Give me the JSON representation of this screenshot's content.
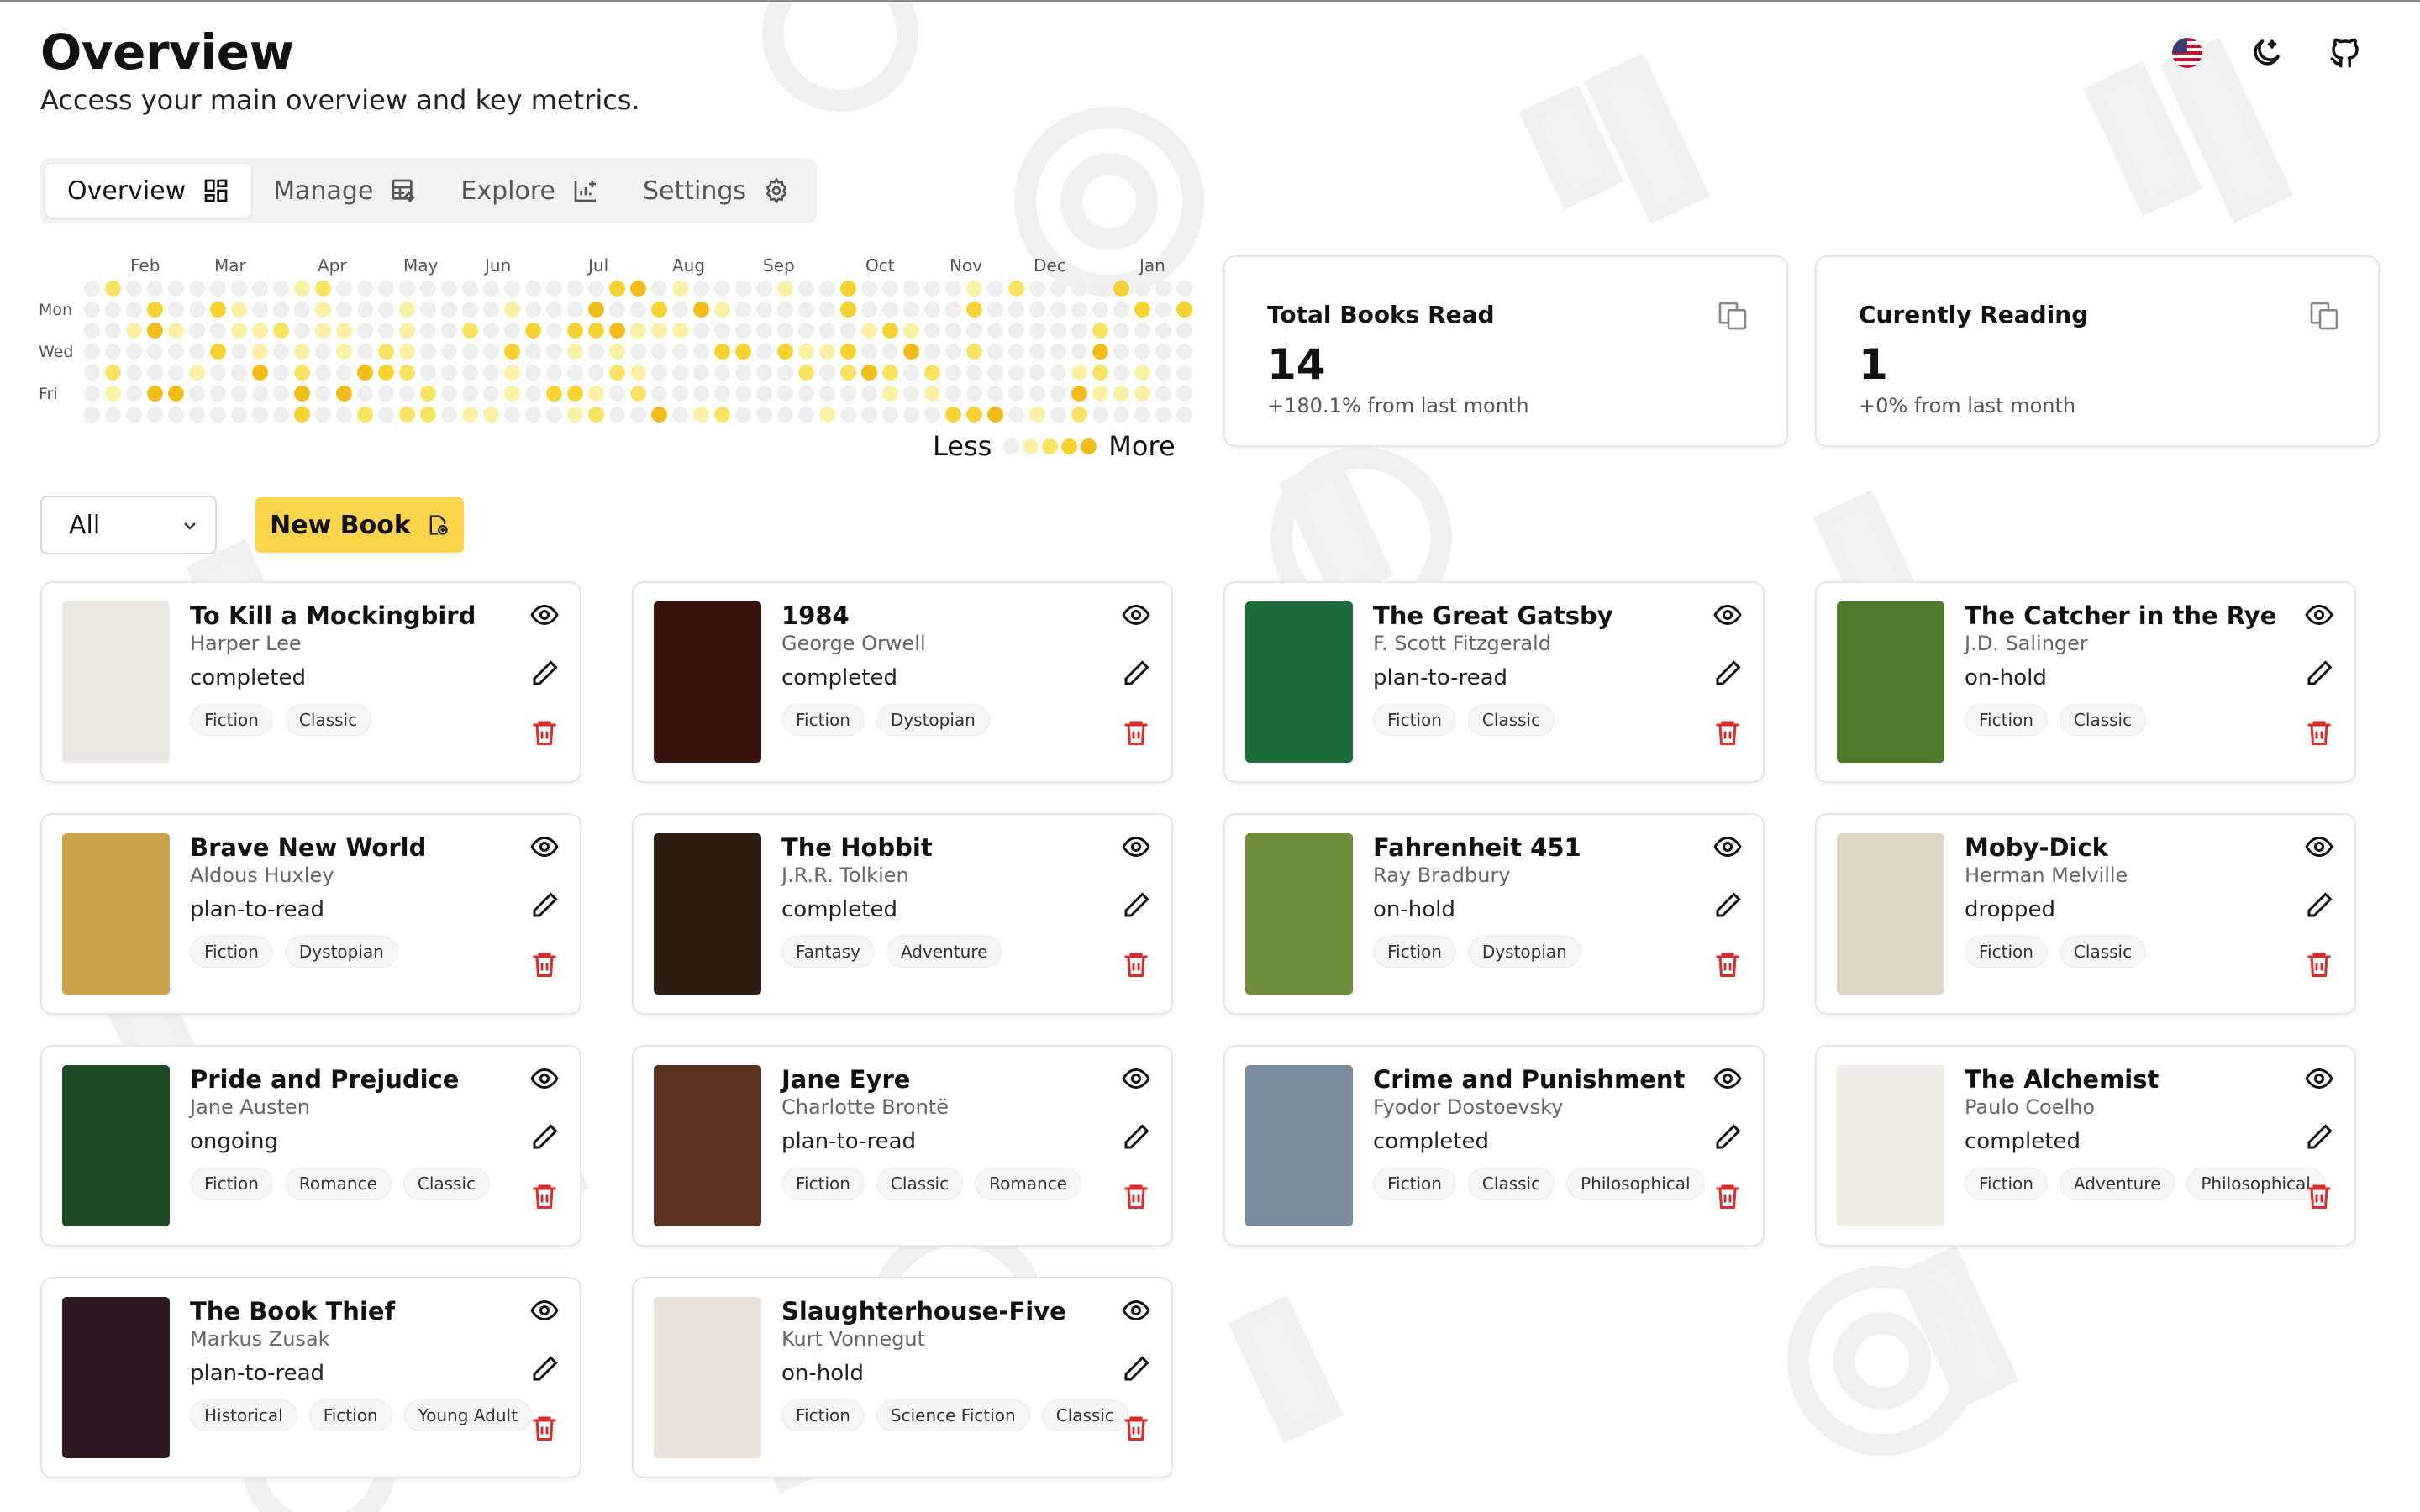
{
  "header": {
    "title": "Overview",
    "subtitle": "Access your main overview and key metrics.",
    "icons": [
      "us-flag-icon",
      "moon-icon",
      "github-icon"
    ]
  },
  "tabs": [
    {
      "label": "Overview",
      "icon": "grid-icon",
      "active": true
    },
    {
      "label": "Manage",
      "icon": "table-edit-icon",
      "active": false
    },
    {
      "label": "Explore",
      "icon": "chart-add-icon",
      "active": false
    },
    {
      "label": "Settings",
      "icon": "gear-icon",
      "active": false
    }
  ],
  "heatmap": {
    "months": [
      "Feb",
      "Mar",
      "Apr",
      "May",
      "Jun",
      "Jul",
      "Aug",
      "Sep",
      "Oct",
      "Nov",
      "Dec",
      "Jan"
    ],
    "days": [
      "Mon",
      "Wed",
      "Fri"
    ],
    "legend_less": "Less",
    "legend_more": "More",
    "colors": [
      "#eeeeee",
      "#fbf1a6",
      "#f9e364",
      "#f7d233",
      "#f2bd1a"
    ]
  },
  "stats": [
    {
      "title": "Total Books Read",
      "value": "14",
      "change": "+180.1% from last month",
      "icon": "copy-icon"
    },
    {
      "title": "Curently Reading",
      "value": "1",
      "change": "+0% from last month",
      "icon": "copy-icon"
    }
  ],
  "toolbar": {
    "filter_value": "All",
    "new_book_label": "New Book"
  },
  "books": [
    {
      "title": "To Kill a Mockingbird",
      "author": "Harper Lee",
      "status": "completed",
      "tags": [
        "Fiction",
        "Classic"
      ]
    },
    {
      "title": "1984",
      "author": "George Orwell",
      "status": "completed",
      "tags": [
        "Fiction",
        "Dystopian"
      ]
    },
    {
      "title": "The Great Gatsby",
      "author": "F. Scott Fitzgerald",
      "status": "plan-to-read",
      "tags": [
        "Fiction",
        "Classic"
      ]
    },
    {
      "title": "The Catcher in the Rye",
      "author": "J.D. Salinger",
      "status": "on-hold",
      "tags": [
        "Fiction",
        "Classic"
      ]
    },
    {
      "title": "Brave New World",
      "author": "Aldous Huxley",
      "status": "plan-to-read",
      "tags": [
        "Fiction",
        "Dystopian"
      ]
    },
    {
      "title": "The Hobbit",
      "author": "J.R.R. Tolkien",
      "status": "completed",
      "tags": [
        "Fantasy",
        "Adventure"
      ]
    },
    {
      "title": "Fahrenheit 451",
      "author": "Ray Bradbury",
      "status": "on-hold",
      "tags": [
        "Fiction",
        "Dystopian"
      ]
    },
    {
      "title": "Moby-Dick",
      "author": "Herman Melville",
      "status": "dropped",
      "tags": [
        "Fiction",
        "Classic"
      ]
    },
    {
      "title": "Pride and Prejudice",
      "author": "Jane Austen",
      "status": "ongoing",
      "tags": [
        "Fiction",
        "Romance",
        "Classic"
      ]
    },
    {
      "title": "Jane Eyre",
      "author": "Charlotte Brontë",
      "status": "plan-to-read",
      "tags": [
        "Fiction",
        "Classic",
        "Romance"
      ]
    },
    {
      "title": "Crime and Punishment",
      "author": "Fyodor Dostoevsky",
      "status": "completed",
      "tags": [
        "Fiction",
        "Classic",
        "Philosophical"
      ]
    },
    {
      "title": "The Alchemist",
      "author": "Paulo Coelho",
      "status": "completed",
      "tags": [
        "Fiction",
        "Adventure",
        "Philosophical"
      ]
    },
    {
      "title": "The Book Thief",
      "author": "Markus Zusak",
      "status": "plan-to-read",
      "tags": [
        "Historical",
        "Fiction",
        "Young Adult"
      ]
    },
    {
      "title": "Slaughterhouse-Five",
      "author": "Kurt Vonnegut",
      "status": "on-hold",
      "tags": [
        "Fiction",
        "Science Fiction",
        "Classic"
      ]
    }
  ],
  "cover_colors": [
    "#ece9e3",
    "#3a120c",
    "#1d6b3a",
    "#4d7a2c",
    "#c9a24a",
    "#2b1f14",
    "#6e8c3a",
    "#ddd7cc",
    "#1f4a2a",
    "#5a3320",
    "#7b8c9e",
    "#efece6",
    "#2b1a24",
    "#e7e3dc"
  ],
  "card_actions": [
    "eye-icon",
    "pencil-icon",
    "trash-icon"
  ]
}
